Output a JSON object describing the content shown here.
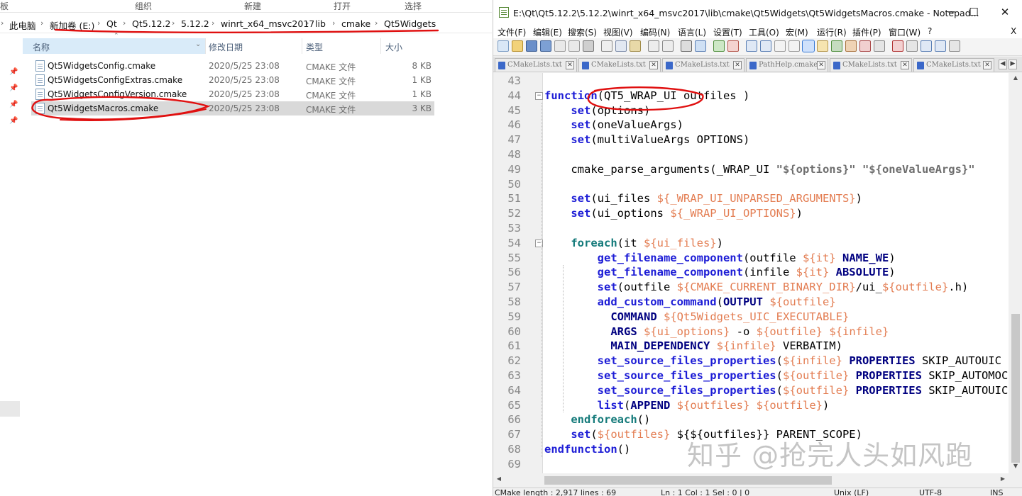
{
  "explorer": {
    "ribbon_groups": [
      "板",
      "组织",
      "新建",
      "打开",
      "选择"
    ],
    "breadcrumb": [
      "此电脑",
      "新加卷 (E:)",
      "Qt",
      "Qt5.12.2",
      "5.12.2",
      "winrt_x64_msvc2017",
      "lib",
      "cmake",
      "Qt5Widgets"
    ],
    "columns": {
      "name": "名称",
      "date": "修改日期",
      "type": "类型",
      "size": "大小"
    },
    "files": [
      {
        "name": "Qt5WidgetsConfig.cmake",
        "date": "2020/5/25 23:08",
        "type": "CMAKE 文件",
        "size": "8 KB"
      },
      {
        "name": "Qt5WidgetsConfigExtras.cmake",
        "date": "2020/5/25 23:08",
        "type": "CMAKE 文件",
        "size": "1 KB"
      },
      {
        "name": "Qt5WidgetsConfigVersion.cmake",
        "date": "2020/5/25 23:08",
        "type": "CMAKE 文件",
        "size": "1 KB"
      },
      {
        "name": "Qt5WidgetsMacros.cmake",
        "date": "2020/5/25 23:08",
        "type": "CMAKE 文件",
        "size": "3 KB"
      }
    ],
    "selected_file_index": 3
  },
  "notepad": {
    "title": "E:\\Qt\\Qt5.12.2\\5.12.2\\winrt_x64_msvc2017\\lib\\cmake\\Qt5Widgets\\Qt5WidgetsMacros.cmake - Notepad...",
    "window_buttons": {
      "minimize": "─",
      "maximize": "☐",
      "close": "✕"
    },
    "menu": [
      "文件(F)",
      "编辑(E)",
      "搜索(S)",
      "视图(V)",
      "编码(N)",
      "语言(L)",
      "设置(T)",
      "工具(O)",
      "宏(M)",
      "运行(R)",
      "插件(P)",
      "窗口(W)",
      "?"
    ],
    "menu_close": "X",
    "tabs": [
      "CMakeLists.txt",
      "CMakeLists.txt",
      "CMakeLists.txt",
      "PathHelp.cmake",
      "CMakeLists.txt",
      "CMakeLists.txt"
    ],
    "code_lines": [
      {
        "n": "43",
        "fold": "",
        "html": ""
      },
      {
        "n": "44",
        "fold": "⊟",
        "html": "<span class='kw'>function</span>(QT5_WRAP_UI outfiles )"
      },
      {
        "n": "45",
        "fold": "",
        "html": "    <span class='kw'>set</span>(options)"
      },
      {
        "n": "46",
        "fold": "",
        "html": "    <span class='kw'>set</span>(oneValueArgs)"
      },
      {
        "n": "47",
        "fold": "",
        "html": "    <span class='kw'>set</span>(multiValueArgs OPTIONS)"
      },
      {
        "n": "48",
        "fold": "",
        "html": ""
      },
      {
        "n": "49",
        "fold": "",
        "html": "    cmake_parse_arguments(_WRAP_UI <span class='strb'>\"${options}\"</span> <span class='strb'>\"${oneValueArgs}\"</span>"
      },
      {
        "n": "50",
        "fold": "",
        "html": ""
      },
      {
        "n": "51",
        "fold": "",
        "html": "    <span class='kw'>set</span>(ui_files <span class='var'>${_WRAP_UI_UNPARSED_ARGUMENTS}</span>)"
      },
      {
        "n": "52",
        "fold": "",
        "html": "    <span class='kw'>set</span>(ui_options <span class='var'>${_WRAP_UI_OPTIONS}</span>)"
      },
      {
        "n": "53",
        "fold": "",
        "html": ""
      },
      {
        "n": "54",
        "fold": "⊟",
        "html": "    <span class='kw-teal'>foreach</span>(it <span class='var'>${ui_files}</span>)"
      },
      {
        "n": "55",
        "fold": "",
        "html": "        <span class='fn'>get_filename_component</span>(outfile <span class='var'>${it}</span> <span class='arg'>NAME_WE</span>)"
      },
      {
        "n": "56",
        "fold": "",
        "html": "        <span class='fn'>get_filename_component</span>(infile <span class='var'>${it}</span> <span class='arg'>ABSOLUTE</span>)"
      },
      {
        "n": "57",
        "fold": "",
        "html": "        <span class='kw'>set</span>(outfile <span class='var'>${CMAKE_CURRENT_BINARY_DIR}</span>/ui_<span class='var'>${outfile}</span>.h)"
      },
      {
        "n": "58",
        "fold": "",
        "html": "        <span class='fn'>add_custom_command</span>(<span class='arg'>OUTPUT</span> <span class='var'>${outfile}</span>"
      },
      {
        "n": "59",
        "fold": "",
        "html": "          <span class='arg'>COMMAND</span> <span class='var'>${Qt5Widgets_UIC_EXECUTABLE}</span>"
      },
      {
        "n": "60",
        "fold": "",
        "html": "          <span class='arg'>ARGS</span> <span class='var'>${ui_options}</span> -o <span class='var'>${outfile}</span> <span class='var'>${infile}</span>"
      },
      {
        "n": "61",
        "fold": "",
        "html": "          <span class='arg'>MAIN_DEPENDENCY</span> <span class='var'>${infile}</span> VERBATIM)"
      },
      {
        "n": "62",
        "fold": "",
        "html": "        <span class='fn'>set_source_files_properties</span>(<span class='var'>${infile}</span> <span class='arg'>PROPERTIES</span> SKIP_AUTOUIC ON)"
      },
      {
        "n": "63",
        "fold": "",
        "html": "        <span class='fn'>set_source_files_properties</span>(<span class='var'>${outfile}</span> <span class='arg'>PROPERTIES</span> SKIP_AUTOMOC ON)"
      },
      {
        "n": "64",
        "fold": "",
        "html": "        <span class='fn'>set_source_files_properties</span>(<span class='var'>${outfile}</span> <span class='arg'>PROPERTIES</span> SKIP_AUTOUIC ON)"
      },
      {
        "n": "65",
        "fold": "",
        "html": "        <span class='fn'>list</span>(<span class='arg'>APPEND</span> <span class='var'>${outfiles}</span> <span class='var'>${outfile}</span>)"
      },
      {
        "n": "66",
        "fold": "",
        "html": "    <span class='kw-teal'>endforeach</span>()"
      },
      {
        "n": "67",
        "fold": "",
        "html": "    <span class='kw'>set</span>(<span class='var'>${outfiles}</span> ${${outfiles}} PARENT_SCOPE)"
      },
      {
        "n": "68",
        "fold": "",
        "html": "<span class='kw'>endfunction</span>()"
      },
      {
        "n": "69",
        "fold": "",
        "html": ""
      }
    ],
    "status": {
      "length": "CMake  length : 2,917    lines : 69",
      "pos": "Ln : 1    Col : 1    Sel : 0 | 0",
      "eol": "Unix (LF)",
      "enc": "UTF-8",
      "mode": "INS"
    }
  },
  "watermark": "知乎 @抢完人头如风跑",
  "annotation_color": "#e01010"
}
